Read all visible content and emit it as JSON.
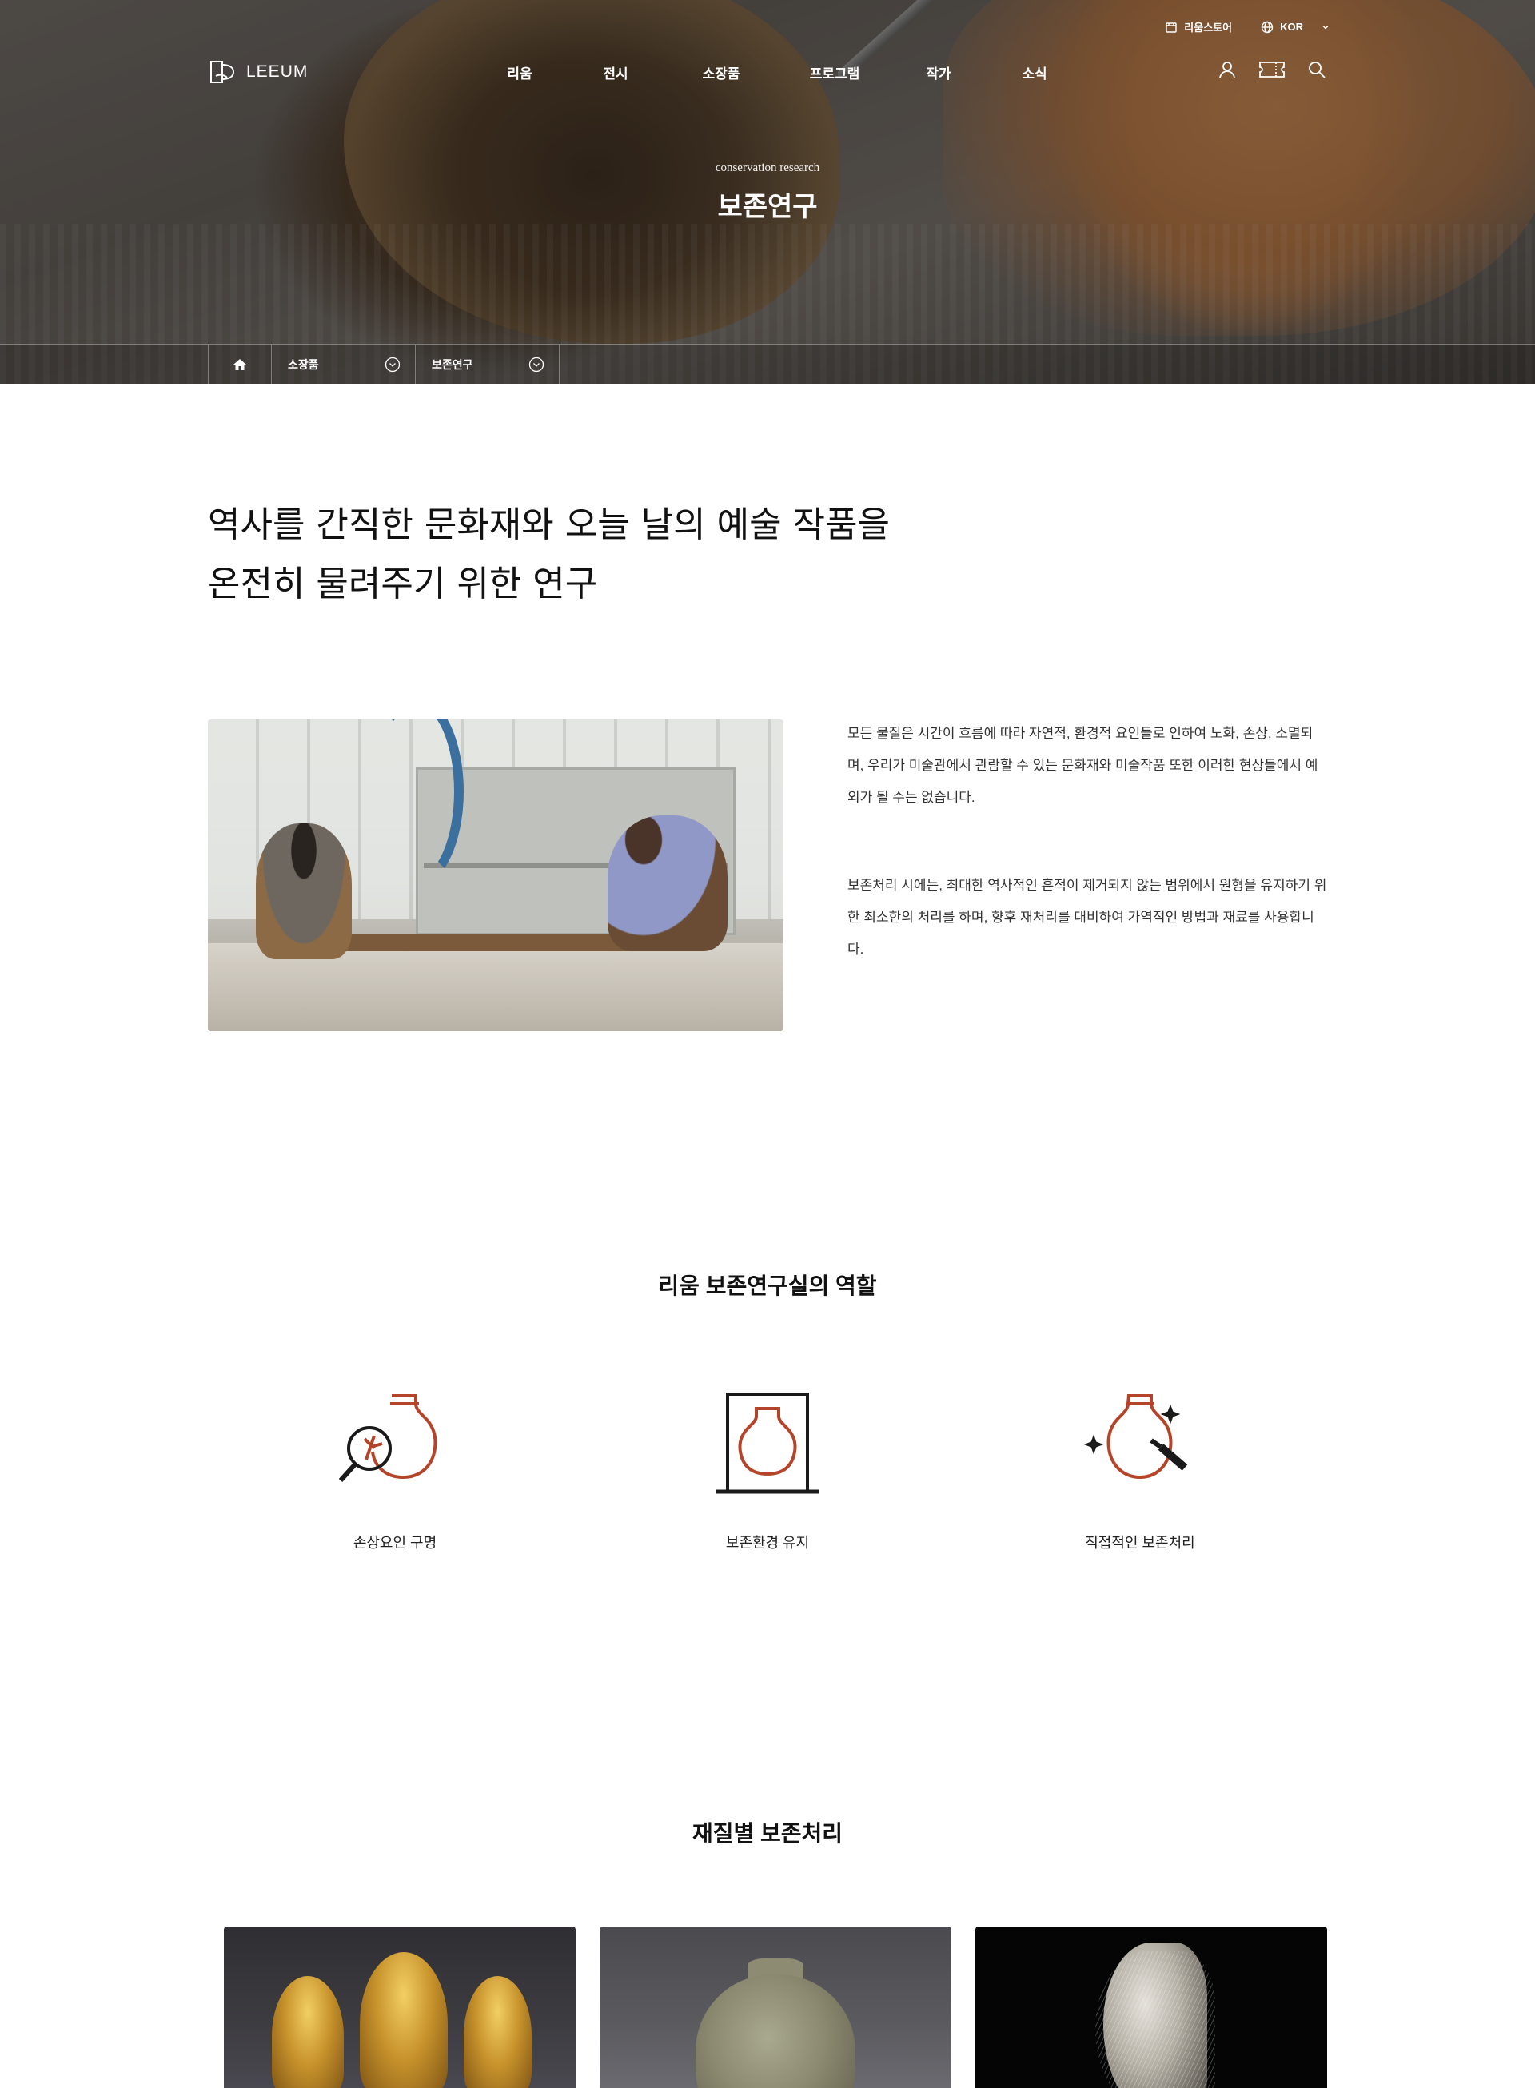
{
  "topbar": {
    "store_label": "리움스토어",
    "lang_label": "KOR"
  },
  "header": {
    "logo_text": "LEEUM",
    "menu": [
      "리움",
      "전시",
      "소장품",
      "프로그램",
      "작가",
      "소식"
    ]
  },
  "hero": {
    "subtitle": "conservation research",
    "title": "보존연구"
  },
  "breadcrumb": {
    "items": [
      "소장품",
      "보존연구"
    ]
  },
  "intro": {
    "heading_line1": "역사를 간직한 문화재와 오늘 날의 예술 작품을",
    "heading_line2": "온전히 물려주기 위한 연구",
    "paragraph1": "모든 물질은 시간이 흐름에 따라 자연적, 환경적 요인들로 인하여 노화, 손상, 소멸되며, 우리가 미술관에서 관람할 수 있는 문화재와 미술작품 또한 이러한 현상들에서 예외가 될 수는 없습니다.",
    "paragraph2": "보존처리 시에는, 최대한 역사적인 흔적이 제거되지 않는 범위에서 원형을 유지하기 위한 최소한의 처리를 하며, 향후 재처리를 대비하여 가역적인 방법과 재료를 사용합니다."
  },
  "roles": {
    "title": "리움 보존연구실의 역할",
    "items": [
      {
        "label": "손상요인 구명",
        "icon": "vase-magnifier-icon"
      },
      {
        "label": "보존환경 유지",
        "icon": "vase-display-case-icon"
      },
      {
        "label": "직접적인 보존처리",
        "icon": "vase-brush-icon"
      }
    ]
  },
  "materials": {
    "title": "재질별 보존처리"
  },
  "colors": {
    "accent": "#b5452a",
    "text": "#111111",
    "body_text": "#333333"
  }
}
